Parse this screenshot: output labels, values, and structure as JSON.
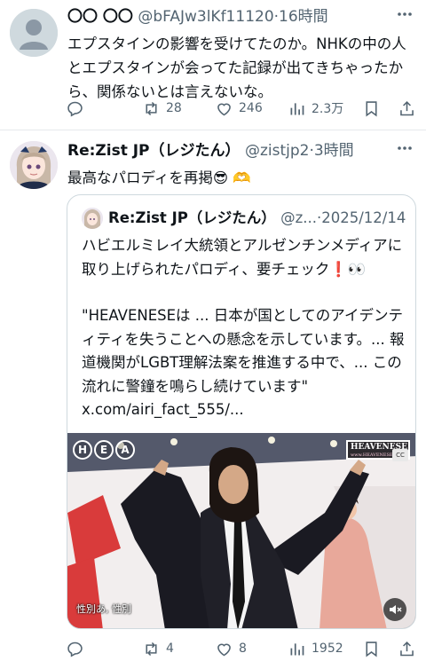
{
  "tweets": [
    {
      "display_name": "〇〇 〇〇",
      "handle": "@bFAJw3lKf11120",
      "dot": "·",
      "time": "16時間",
      "text": "エプスタインの影響を受けてたのか。NHKの中の人とエプスタインが会ってた記録が出てきちゃったから、関係ないとは言えないな。",
      "more_icon": "ellipsis-icon",
      "actions": {
        "reply": {
          "icon": "reply-icon",
          "count": ""
        },
        "repost": {
          "icon": "repost-icon",
          "count": "28"
        },
        "like": {
          "icon": "heart-icon",
          "count": "246"
        },
        "views": {
          "icon": "views-icon",
          "count": "2.3万"
        },
        "bookmark": {
          "icon": "bookmark-icon"
        },
        "share": {
          "icon": "share-icon"
        }
      }
    },
    {
      "display_name": "Re:Zist JP（レジたん）",
      "handle": "@zistjp2",
      "dot": "·",
      "time": "3時間",
      "text": "最高なパロディを再掲😎 🫶",
      "more_icon": "ellipsis-icon",
      "quote": {
        "display_name": "Re:Zist JP（レジたん）",
        "handle": "@z...",
        "dot": "·",
        "date": "2025/12/14",
        "text1": "ハビエルミレイ大統領とアルゼンチンメディアに取り上げられたパロディ、要チェック❗👀",
        "text2": "\"HEAVENESEは ... 日本が国としてのアイデンティティを失うことへの懸念を示しています。... 報道機関がLGBT理解法案を推進する中で、... この流れに警鐘を鳴らし続けています\"",
        "link": "x.com/airi_fact_555/...",
        "media": {
          "logo_letters": [
            "H",
            "E",
            "A"
          ],
          "brand": "HEAVENESE",
          "brand_url": "www.HEAVENESE.net",
          "cc": "CC",
          "subtitle": "性別あ, 性別",
          "mute_icon": "mute-icon"
        }
      },
      "actions": {
        "reply": {
          "icon": "reply-icon",
          "count": ""
        },
        "repost": {
          "icon": "repost-icon",
          "count": "4"
        },
        "like": {
          "icon": "heart-icon",
          "count": "8"
        },
        "views": {
          "icon": "views-icon",
          "count": "1952"
        },
        "bookmark": {
          "icon": "bookmark-icon"
        },
        "share": {
          "icon": "share-icon"
        }
      }
    }
  ],
  "colors": {
    "text": "#0f1419",
    "secondary": "#536471",
    "border": "#cfd9de"
  }
}
